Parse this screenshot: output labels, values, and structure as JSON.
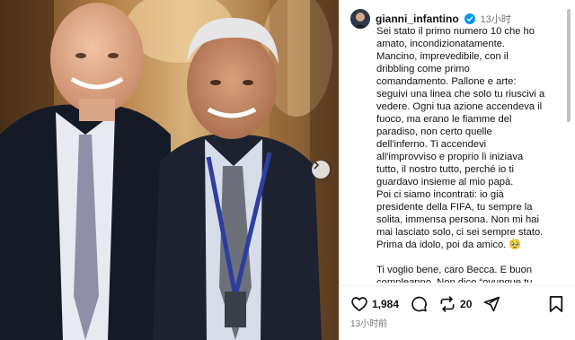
{
  "post": {
    "username": "gianni_infantino",
    "timestamp": "13小时",
    "caption_paragraphs": [
      "Sei stato il primo numero 10 che ho\namato, incondizionatamente.\nMancino, imprevedibile, con il\ndribbling come primo\ncomandamento. Pallone e arte:\nseguivi una linea che solo tu riuscivi a\nvedere. Ogni tua azione accendeva il\nfuoco, ma erano le fiamme del\nparadiso, non certo quelle\ndell'inferno. Ti accendevi\nall'improvviso e proprio lì iniziava\ntutto, il nostro tutto, perché io ti\nguardavo insieme al mio papà.\nPoi ci siamo incontrati: io già\npresidente della FIFA, tu sempre la\nsolita, immensa persona. Non mi hai\nmai lasciato solo, ci sei sempre stato.\nPrima da idolo, poi da amico. 🥹",
      "Ti voglio bene, caro Becca. E buon\ncompleanno. Non dico “ovunque tu"
    ],
    "likes": "1,984",
    "shares": "20",
    "bottom_time": "13小时前"
  },
  "colors": {
    "verified": "#0095f6",
    "text": "#111111",
    "muted": "#737373"
  },
  "icons": [
    "next-arrow-icon",
    "verified-badge-icon",
    "heart-icon",
    "comment-icon",
    "repost-icon",
    "share-icon",
    "bookmark-icon"
  ]
}
